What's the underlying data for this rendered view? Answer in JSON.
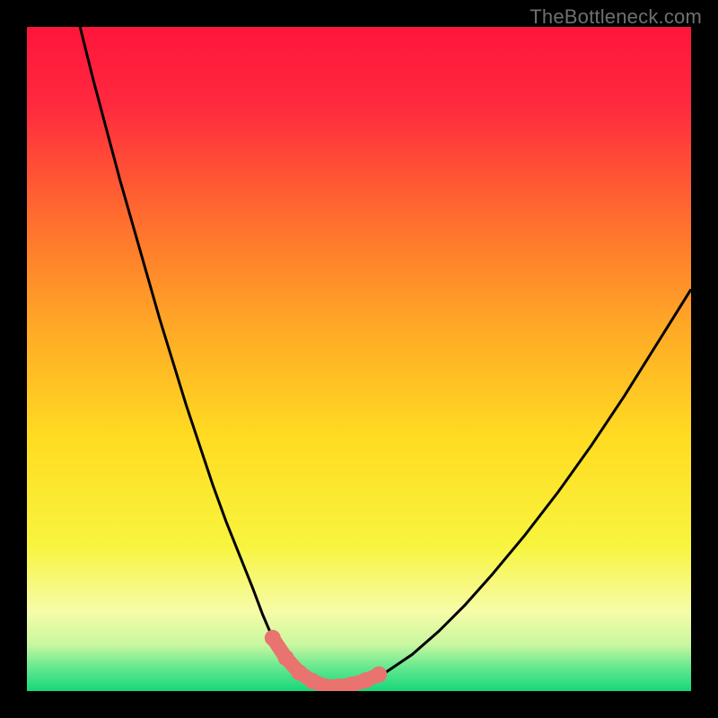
{
  "watermark": "TheBottleneck.com",
  "colors": {
    "gradient_stops": [
      {
        "offset": 0.0,
        "color": "#ff153b"
      },
      {
        "offset": 0.12,
        "color": "#ff2a3e"
      },
      {
        "offset": 0.28,
        "color": "#ff6a2f"
      },
      {
        "offset": 0.45,
        "color": "#ffa826"
      },
      {
        "offset": 0.62,
        "color": "#ffdc22"
      },
      {
        "offset": 0.78,
        "color": "#f8f43e"
      },
      {
        "offset": 0.88,
        "color": "#f6fca8"
      },
      {
        "offset": 0.93,
        "color": "#c9f7a0"
      },
      {
        "offset": 0.965,
        "color": "#63e88f"
      },
      {
        "offset": 1.0,
        "color": "#17d77a"
      }
    ],
    "curve": "#000000",
    "marker_fill": "#e9736f",
    "marker_stroke": "#e9736f",
    "background": "#000000"
  },
  "chart_data": {
    "type": "line",
    "title": "",
    "xlabel": "",
    "ylabel": "",
    "xlim": [
      0,
      100
    ],
    "ylim": [
      0,
      100
    ],
    "series": [
      {
        "name": "bottleneck-curve",
        "x": [
          8,
          10,
          12,
          14,
          16,
          18,
          20,
          22,
          24,
          26,
          28,
          30,
          32,
          34,
          35.5,
          37,
          39,
          41,
          43,
          45,
          47,
          50,
          54,
          58,
          62,
          66,
          70,
          75,
          80,
          85,
          90,
          95,
          100
        ],
        "y": [
          100,
          92,
          84.5,
          77,
          70,
          63,
          56,
          49.5,
          43,
          37,
          31,
          25.5,
          20.5,
          15.5,
          11.5,
          8,
          5,
          2.8,
          1.5,
          0.7,
          0.7,
          1.2,
          2.8,
          5.5,
          9,
          13,
          17.5,
          23.5,
          30,
          37,
          44.5,
          52.5,
          60.5
        ]
      }
    ],
    "markers": {
      "name": "highlight-points",
      "x": [
        37,
        39,
        41,
        43,
        45,
        47,
        49,
        51,
        53
      ],
      "y": [
        8,
        5,
        2.8,
        1.5,
        0.7,
        0.7,
        1.0,
        1.6,
        2.5
      ]
    }
  }
}
